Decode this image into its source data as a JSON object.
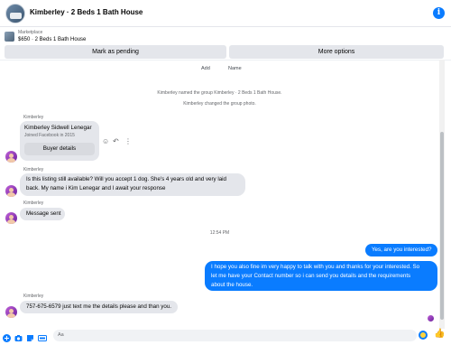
{
  "header": {
    "title": "Kimberley · 2 Beds 1 Bath House",
    "info_icon": "i"
  },
  "marketplace": {
    "label": "Marketplace",
    "listing": "$650 · 2 Beds 1 Bath House"
  },
  "actions": {
    "mark_pending": "Mark as pending",
    "more_options": "More options"
  },
  "group_setup": {
    "add_label": "Add",
    "name_label": "Name"
  },
  "system_messages": [
    "Kimberley named the group Kimberley · 2 Beds 1 Bath House.",
    "Kimberley changed the group photo."
  ],
  "messages": [
    {
      "sender": "Kimberley",
      "card": {
        "name": "Kimberley Sidwell Lenegar",
        "subtitle": "Joined Facebook in 2015",
        "button": "Buyer details"
      }
    },
    {
      "sender": "Kimberley",
      "line1": "Is this listing still available? Will you accept 1 dog. She's 4 years old and very laid",
      "line2": "back. My name i Kim Lenegar and I await your response"
    },
    {
      "sender": "Kimberley",
      "text": "Message sent"
    },
    {
      "timestamp": "12:54 PM"
    },
    {
      "outgoing": true,
      "text": "Yes, are you interested?"
    },
    {
      "outgoing": true,
      "line1": "I hope you also fine im very happy to talk with you and thanks for your interested. So",
      "line2": "let me have your Contact number so i can send you details and the requirements",
      "line3": "about the house."
    },
    {
      "sender": "Kimberley",
      "text": "757-675-6579 just text me the details please and than you."
    }
  ],
  "composer": {
    "placeholder": "Aa"
  },
  "colors": {
    "accent": "#0a7cff",
    "incoming_bubble": "#e4e6eb"
  }
}
